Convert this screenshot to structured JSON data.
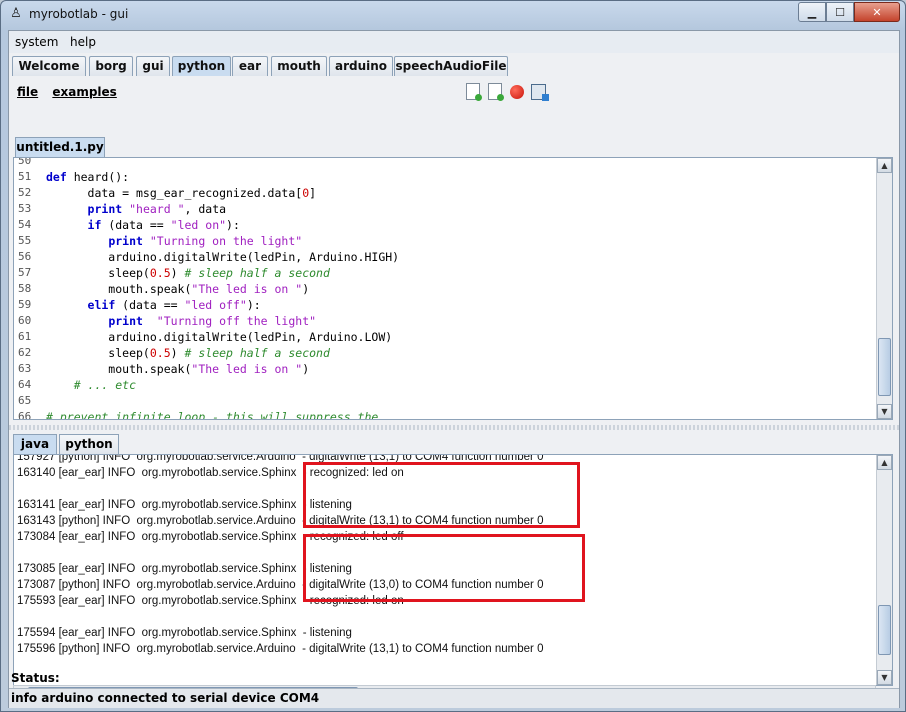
{
  "window": {
    "title": "myrobotlab - gui",
    "icon": "robot-icon",
    "buttons": {
      "min": "▁",
      "max": "☐",
      "close": "✕"
    }
  },
  "menubar": {
    "items": [
      "system",
      "help"
    ]
  },
  "tabs": [
    "Welcome",
    "borg",
    "gui",
    "python",
    "ear",
    "mouth",
    "arduino",
    "speechAudioFile"
  ],
  "selected_tab": "python",
  "python": {
    "file_menu": [
      "file",
      "examples"
    ],
    "toolbar": [
      "new-file-icon",
      "open-file-icon",
      "record-icon",
      "save-file-icon"
    ],
    "editor_tab": "untitled.1.py",
    "code_lines": [
      {
        "n": "50",
        "t": ""
      },
      {
        "n": "51",
        "t": "def heard():"
      },
      {
        "n": "52",
        "t": "      data = msg_ear_recognized.data[0]"
      },
      {
        "n": "53",
        "t": "      print \"heard \", data"
      },
      {
        "n": "54",
        "t": "      if (data == \"led on\"):"
      },
      {
        "n": "55",
        "t": "         print \"Turning on the light\""
      },
      {
        "n": "56",
        "t": "         arduino.digitalWrite(ledPin, Arduino.HIGH)"
      },
      {
        "n": "57",
        "t": "         sleep(0.5) # sleep half a second"
      },
      {
        "n": "58",
        "t": "         mouth.speak(\"The led is on \")"
      },
      {
        "n": "59",
        "t": "      elif (data == \"led off\"):"
      },
      {
        "n": "60",
        "t": "         print  \"Turning off the light\""
      },
      {
        "n": "61",
        "t": "         arduino.digitalWrite(ledPin, Arduino.LOW)"
      },
      {
        "n": "62",
        "t": "         sleep(0.5) # sleep half a second"
      },
      {
        "n": "63",
        "t": "         mouth.speak(\"The led is on \")"
      },
      {
        "n": "64",
        "t": "    # ... etc"
      },
      {
        "n": "65",
        "t": ""
      },
      {
        "n": "66",
        "t": "# prevent infinite loop - this will suppress the"
      }
    ],
    "console_tabs": [
      "java",
      "python"
    ],
    "selected_console_tab": "java",
    "log_lines": [
      "157927 [python] INFO  org.myrobotlab.service.Arduino  - digitalWrite (13,1) to COM4 function number 0",
      "163140 [ear_ear] INFO  org.myrobotlab.service.Sphinx  - recognized: led on",
      "",
      "163141 [ear_ear] INFO  org.myrobotlab.service.Sphinx  - listening",
      "163143 [python] INFO  org.myrobotlab.service.Arduino  - digitalWrite (13,1) to COM4 function number 0",
      "173084 [ear_ear] INFO  org.myrobotlab.service.Sphinx  - recognized: led off",
      "",
      "173085 [ear_ear] INFO  org.myrobotlab.service.Sphinx  - listening",
      "173087 [python] INFO  org.myrobotlab.service.Arduino  - digitalWrite (13,0) to COM4 function number 0",
      "175593 [ear_ear] INFO  org.myrobotlab.service.Sphinx  - recognized: led on",
      "",
      "175594 [ear_ear] INFO  org.myrobotlab.service.Sphinx  - listening",
      "175596 [python] INFO  org.myrobotlab.service.Arduino  - digitalWrite (13,1) to COM4 function number 0"
    ]
  },
  "status": {
    "label": "Status:",
    "message": "info arduino connected to serial device COM4"
  },
  "colors": {
    "highlight": "#e0141e",
    "keyword": "#0000cc",
    "string": "#a020c0",
    "number": "#cc0000",
    "comment": "#2e8b2e"
  }
}
